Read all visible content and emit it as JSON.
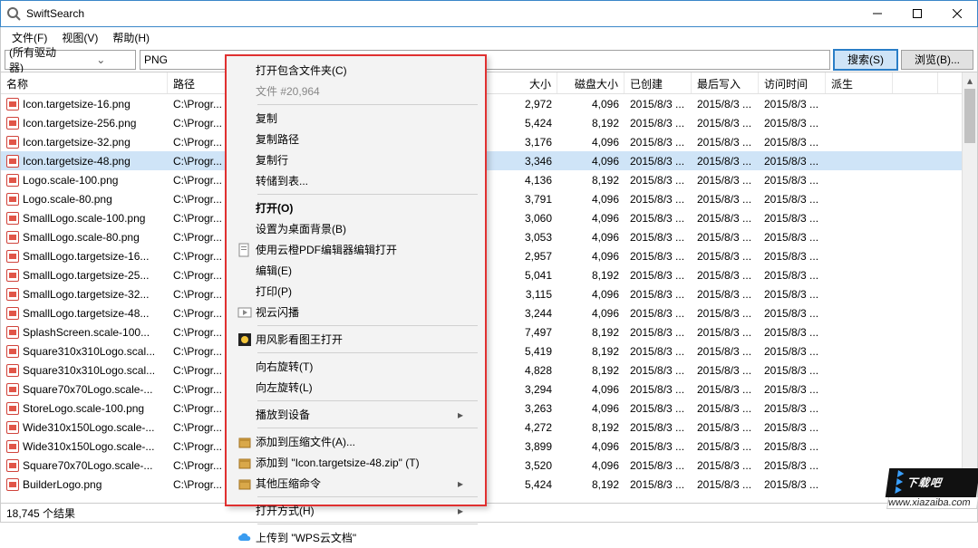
{
  "window": {
    "title": "SwiftSearch"
  },
  "menubar": {
    "file": "文件(F)",
    "view": "视图(V)",
    "help": "帮助(H)"
  },
  "toolbar": {
    "drive": "(所有驱动器)",
    "query": "PNG",
    "search": "搜索(S)",
    "browse": "浏览(B)..."
  },
  "columns": {
    "name": "名称",
    "path": "路径",
    "size": "大小",
    "disk": "磁盘大小",
    "created": "已创建",
    "modified": "最后写入",
    "accessed": "访问时间",
    "derived": "派生"
  },
  "rows": [
    {
      "name": "Icon.targetsize-16.png",
      "path": "C:\\Progr...",
      "size": "2,972",
      "disk": "4,096",
      "c": "2015/8/3 ...",
      "m": "2015/8/3 ...",
      "a": "2015/8/3 ..."
    },
    {
      "name": "Icon.targetsize-256.png",
      "path": "C:\\Progr...",
      "size": "5,424",
      "disk": "8,192",
      "c": "2015/8/3 ...",
      "m": "2015/8/3 ...",
      "a": "2015/8/3 ..."
    },
    {
      "name": "Icon.targetsize-32.png",
      "path": "C:\\Progr...",
      "size": "3,176",
      "disk": "4,096",
      "c": "2015/8/3 ...",
      "m": "2015/8/3 ...",
      "a": "2015/8/3 ..."
    },
    {
      "name": "Icon.targetsize-48.png",
      "path": "C:\\Progr...",
      "size": "3,346",
      "disk": "4,096",
      "c": "2015/8/3 ...",
      "m": "2015/8/3 ...",
      "a": "2015/8/3 ...",
      "selected": true
    },
    {
      "name": "Logo.scale-100.png",
      "path": "C:\\Progr...",
      "size": "4,136",
      "disk": "8,192",
      "c": "2015/8/3 ...",
      "m": "2015/8/3 ...",
      "a": "2015/8/3 ..."
    },
    {
      "name": "Logo.scale-80.png",
      "path": "C:\\Progr...",
      "size": "3,791",
      "disk": "4,096",
      "c": "2015/8/3 ...",
      "m": "2015/8/3 ...",
      "a": "2015/8/3 ..."
    },
    {
      "name": "SmallLogo.scale-100.png",
      "path": "C:\\Progr...",
      "size": "3,060",
      "disk": "4,096",
      "c": "2015/8/3 ...",
      "m": "2015/8/3 ...",
      "a": "2015/8/3 ..."
    },
    {
      "name": "SmallLogo.scale-80.png",
      "path": "C:\\Progr...",
      "size": "3,053",
      "disk": "4,096",
      "c": "2015/8/3 ...",
      "m": "2015/8/3 ...",
      "a": "2015/8/3 ..."
    },
    {
      "name": "SmallLogo.targetsize-16...",
      "path": "C:\\Progr...",
      "size": "2,957",
      "disk": "4,096",
      "c": "2015/8/3 ...",
      "m": "2015/8/3 ...",
      "a": "2015/8/3 ..."
    },
    {
      "name": "SmallLogo.targetsize-25...",
      "path": "C:\\Progr...",
      "size": "5,041",
      "disk": "8,192",
      "c": "2015/8/3 ...",
      "m": "2015/8/3 ...",
      "a": "2015/8/3 ..."
    },
    {
      "name": "SmallLogo.targetsize-32...",
      "path": "C:\\Progr...",
      "size": "3,115",
      "disk": "4,096",
      "c": "2015/8/3 ...",
      "m": "2015/8/3 ...",
      "a": "2015/8/3 ..."
    },
    {
      "name": "SmallLogo.targetsize-48...",
      "path": "C:\\Progr...",
      "size": "3,244",
      "disk": "4,096",
      "c": "2015/8/3 ...",
      "m": "2015/8/3 ...",
      "a": "2015/8/3 ..."
    },
    {
      "name": "SplashScreen.scale-100...",
      "path": "C:\\Progr...",
      "size": "7,497",
      "disk": "8,192",
      "c": "2015/8/3 ...",
      "m": "2015/8/3 ...",
      "a": "2015/8/3 ..."
    },
    {
      "name": "Square310x310Logo.scal...",
      "path": "C:\\Progr...",
      "size": "5,419",
      "disk": "8,192",
      "c": "2015/8/3 ...",
      "m": "2015/8/3 ...",
      "a": "2015/8/3 ..."
    },
    {
      "name": "Square310x310Logo.scal...",
      "path": "C:\\Progr...",
      "size": "4,828",
      "disk": "8,192",
      "c": "2015/8/3 ...",
      "m": "2015/8/3 ...",
      "a": "2015/8/3 ..."
    },
    {
      "name": "Square70x70Logo.scale-...",
      "path": "C:\\Progr...",
      "size": "3,294",
      "disk": "4,096",
      "c": "2015/8/3 ...",
      "m": "2015/8/3 ...",
      "a": "2015/8/3 ..."
    },
    {
      "name": "StoreLogo.scale-100.png",
      "path": "C:\\Progr...",
      "size": "3,263",
      "disk": "4,096",
      "c": "2015/8/3 ...",
      "m": "2015/8/3 ...",
      "a": "2015/8/3 ..."
    },
    {
      "name": "Wide310x150Logo.scale-...",
      "path": "C:\\Progr...",
      "size": "4,272",
      "disk": "8,192",
      "c": "2015/8/3 ...",
      "m": "2015/8/3 ...",
      "a": "2015/8/3 ..."
    },
    {
      "name": "Wide310x150Logo.scale-...",
      "path": "C:\\Progr...",
      "size": "3,899",
      "disk": "4,096",
      "c": "2015/8/3 ...",
      "m": "2015/8/3 ...",
      "a": "2015/8/3 ..."
    },
    {
      "name": "Square70x70Logo.scale-...",
      "path": "C:\\Progr...",
      "size": "3,520",
      "disk": "4,096",
      "c": "2015/8/3 ...",
      "m": "2015/8/3 ...",
      "a": "2015/8/3 ..."
    },
    {
      "name": "BuilderLogo.png",
      "path": "C:\\Progr...",
      "size": "5,424",
      "disk": "8,192",
      "c": "2015/8/3 ...",
      "m": "2015/8/3 ...",
      "a": "2015/8/3 ..."
    }
  ],
  "status": {
    "text": "18,745 个结果"
  },
  "ctx": {
    "open_containing": "打开包含文件夹(C)",
    "count": "文件 #20,964",
    "copy": "复制",
    "copy_path": "复制路径",
    "copy_row": "复制行",
    "dump_table": "转储到表...",
    "open": "打开(O)",
    "set_bg": "设置为桌面背景(B)",
    "pdf_edit": "使用云橙PDF编辑器编辑打开",
    "edit": "编辑(E)",
    "print": "打印(P)",
    "shanbo": "视云闪播",
    "fengying": "用风影看图王打开",
    "rotate_r": "向右旋转(T)",
    "rotate_l": "向左旋转(L)",
    "cast": "播放到设备",
    "zip_add": "添加到压缩文件(A)...",
    "zip_named": "添加到 \"Icon.targetsize-48.zip\" (T)",
    "zip_other": "其他压缩命令",
    "open_with": "打开方式(H)",
    "wps_cloud": "上传到 \"WPS云文档\""
  },
  "watermark": {
    "text": "下载吧",
    "url": "www.xiazaiba.com"
  }
}
